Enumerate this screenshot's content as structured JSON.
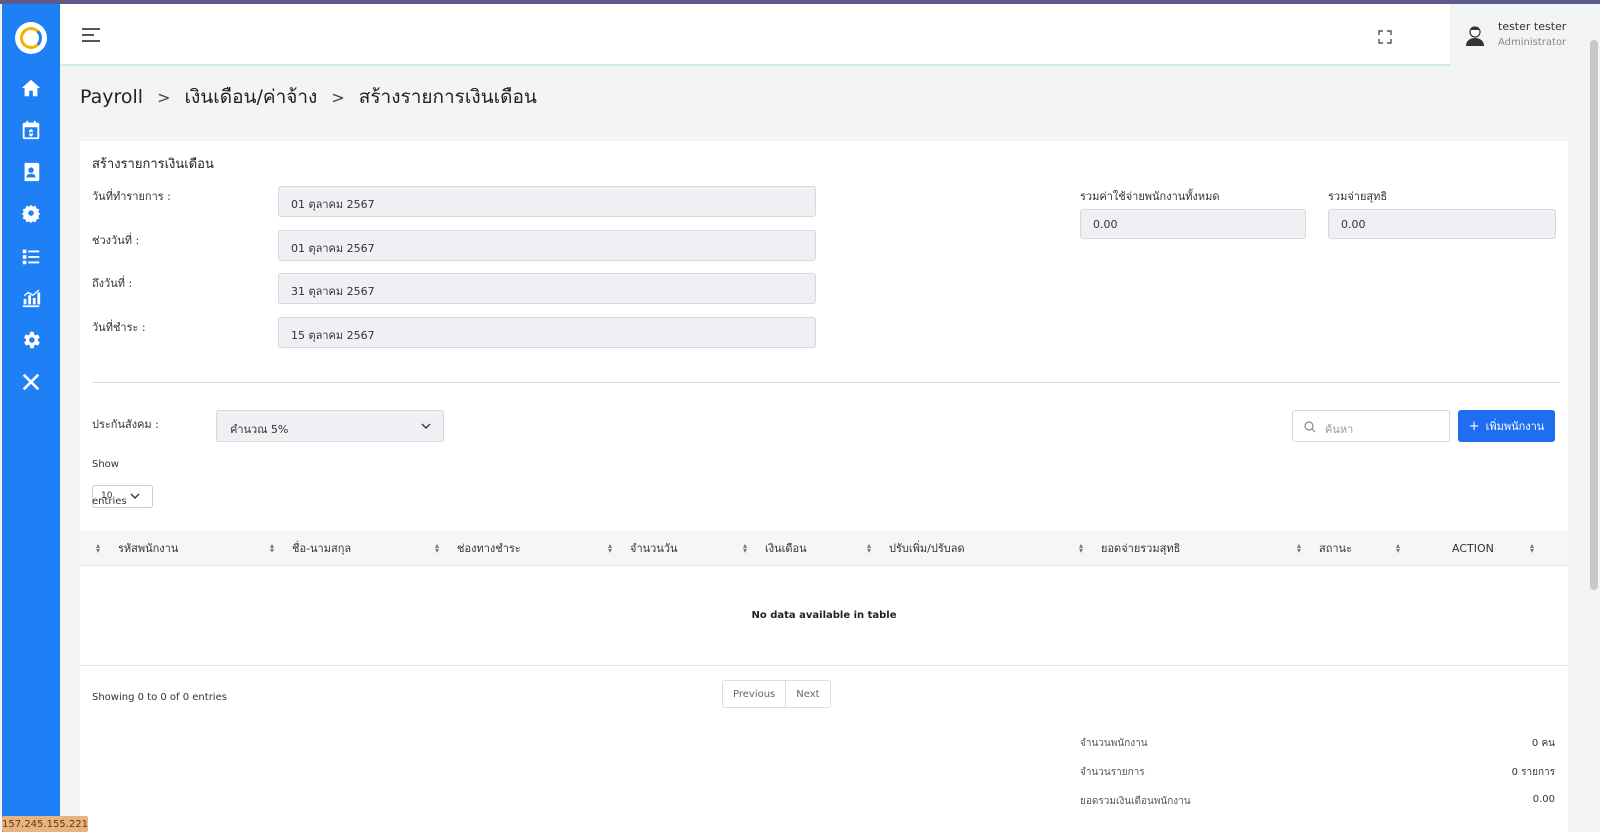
{
  "header": {
    "user_name": "tester tester",
    "user_role": "Administrator"
  },
  "breadcrumb": [
    "Payroll",
    "เงินเดือน/ค่าจ้าง",
    "สร้างรายการเงินเดือน"
  ],
  "form": {
    "title": "สร้างรายการเงินเดือน",
    "transaction_date_label": "วันที่ทำรายการ :",
    "transaction_date_value": "01 ตุลาคม 2567",
    "period_start_label": "ช่วงวันที่ :",
    "period_start_value": "01 ตุลาคม 2567",
    "period_end_label": "ถึงวันที่ :",
    "period_end_value": "31 ตุลาคม 2567",
    "pay_date_label": "วันที่ชำระ :",
    "pay_date_value": "15 ตุลาคม 2567",
    "total_expense_label": "รวมค่าใช้จ่ายพนักงานทั้งหมด",
    "total_expense_value": "0.00",
    "net_total_label": "รวมจ่ายสุทธิ",
    "net_total_value": "0.00",
    "social_security_label": "ประกันสังคม :",
    "social_security_value": "คำนวณ 5%"
  },
  "toolbar": {
    "search_placeholder": "ค้นหา",
    "add_employee_label": "เพิ่มพนักงาน"
  },
  "table": {
    "show_label": "Show",
    "page_size": "10",
    "entries_label": "entries",
    "columns": [
      "รหัสพนักงาน",
      "ชื่อ-นามสกุล",
      "ช่องทางชำระ",
      "จำนวนวัน",
      "เงินเดือน",
      "ปรับเพิ่ม/ปรับลด",
      "ยอดจ่ายรวมสุทธิ",
      "สถานะ",
      "ACTION"
    ],
    "empty_message": "No data available in table",
    "info": "Showing 0 to 0 of 0 entries",
    "prev_label": "Previous",
    "next_label": "Next"
  },
  "summary": {
    "employee_count_label": "จำนวนพนักงาน",
    "employee_count_value": "0 คน",
    "item_count_label": "จำนวนรายการ",
    "item_count_value": "0 รายการ",
    "salary_total_label": "ยอดรวมเงินเดือนพนักงาน",
    "salary_total_value": "0.00"
  },
  "footer": {
    "ip": "157.245.155.221"
  },
  "colors": {
    "sidebar": "#1f7ff5",
    "primary_button": "#1f6df0"
  }
}
